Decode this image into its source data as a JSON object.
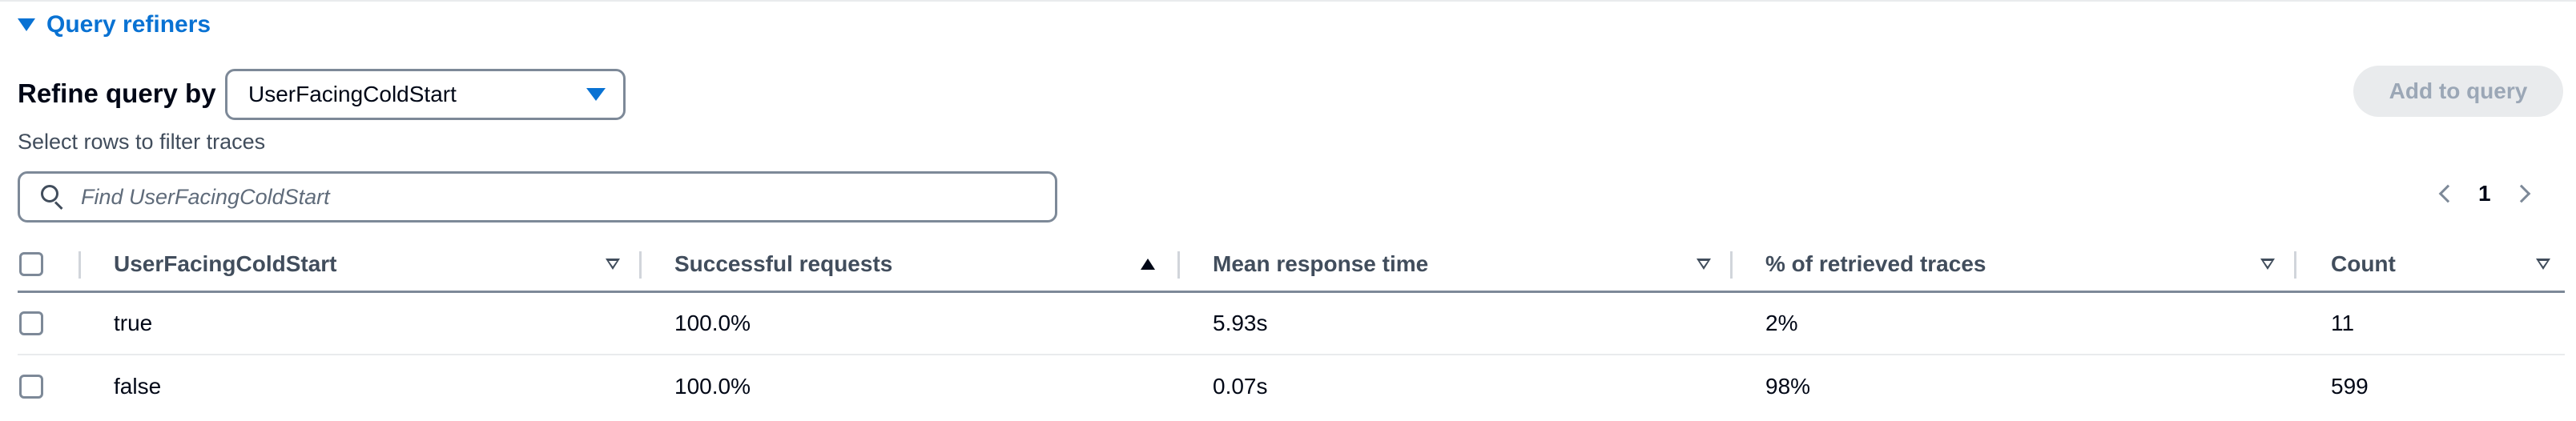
{
  "section": {
    "title": "Query refiners",
    "icon": "caret-down-icon"
  },
  "refine": {
    "label": "Refine query by",
    "selected": "UserFacingColdStart",
    "add_button": "Add to query",
    "helper": "Select rows to filter traces"
  },
  "search": {
    "placeholder": "Find UserFacingColdStart",
    "value": ""
  },
  "pagination": {
    "current_page": "1"
  },
  "table": {
    "columns": [
      {
        "label": "UserFacingColdStart",
        "sort": "unsorted"
      },
      {
        "label": "Successful requests",
        "sort": "ascending"
      },
      {
        "label": "Mean response time",
        "sort": "unsorted"
      },
      {
        "label": "% of retrieved traces",
        "sort": "unsorted"
      },
      {
        "label": "Count",
        "sort": "unsorted"
      }
    ],
    "rows": [
      {
        "value": "true",
        "successful": "100.0%",
        "mean": "5.93s",
        "percent": "2%",
        "count": "11"
      },
      {
        "value": "false",
        "successful": "100.0%",
        "mean": "0.07s",
        "percent": "98%",
        "count": "599"
      }
    ]
  },
  "colors": {
    "accent": "#0972d3",
    "text": "#000716",
    "border": "#7d8998",
    "disabled_bg": "#e9ebed",
    "disabled_text": "#9ba7b6"
  }
}
